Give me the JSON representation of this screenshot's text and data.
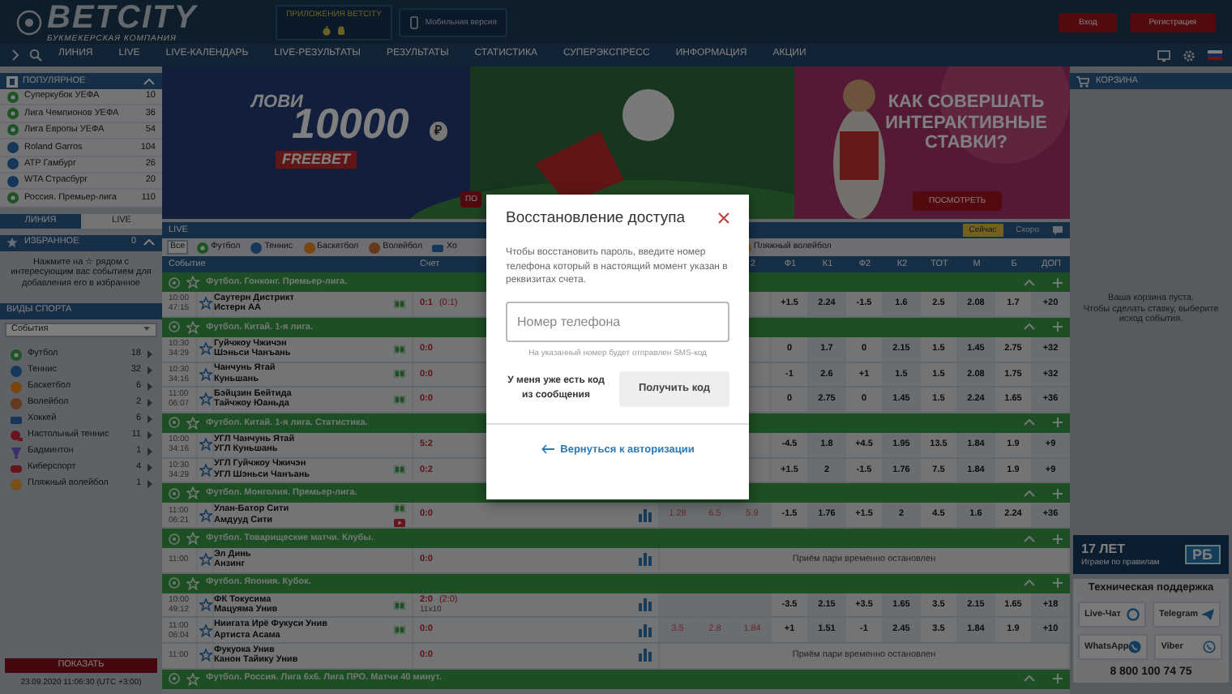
{
  "header": {
    "logo": "BETCITY",
    "tagline": "БУКМЕКЕРСКАЯ КОМПАНИЯ",
    "apps_label": "ПРИЛОЖЕНИЯ BETCITY",
    "mobile_button": "Мобильная версия",
    "login_button": "Вход",
    "register_button": "Регистрация"
  },
  "nav": [
    "ЛИНИЯ",
    "LIVE",
    "LIVE-КАЛЕНДАРЬ",
    "LIVE-РЕЗУЛЬТАТЫ",
    "РЕЗУЛЬТАТЫ",
    "СТАТИСТИКА",
    "СУПЕРЭКСПРЕСС",
    "ИНФОРМАЦИЯ",
    "АКЦИИ"
  ],
  "popular": {
    "title": "ПОПУЛЯРНОЕ",
    "items": [
      {
        "name": "Суперкубок УЕФА",
        "count": "10",
        "kind": "football"
      },
      {
        "name": "Лига Чемпионов УЕФА",
        "count": "36",
        "kind": "football"
      },
      {
        "name": "Лига Европы УЕФА",
        "count": "54",
        "kind": "football"
      },
      {
        "name": "Roland Garros",
        "count": "104",
        "kind": "tennis"
      },
      {
        "name": "ATP Гамбург",
        "count": "26",
        "kind": "tennis"
      },
      {
        "name": "WTA Страсбург",
        "count": "20",
        "kind": "tennis"
      },
      {
        "name": "Россия. Премьер-лига",
        "count": "110",
        "kind": "football"
      }
    ]
  },
  "side_tabs": [
    {
      "label": "ЛИНИЯ",
      "selected": false
    },
    {
      "label": "LIVE",
      "selected": true
    }
  ],
  "favorites": {
    "title": "ИЗБРАННОЕ",
    "count": "0",
    "hint": "Нажмите на ☆ рядом с интересующим вас событием для добавления его в избранное"
  },
  "sports": {
    "title": "ВИДЫ СПОРТА",
    "filter": "События",
    "items": [
      {
        "name": "Футбол",
        "count": "18",
        "kind": "football"
      },
      {
        "name": "Теннис",
        "count": "32",
        "kind": "tennis"
      },
      {
        "name": "Баскетбол",
        "count": "6",
        "kind": "basketball"
      },
      {
        "name": "Волейбол",
        "count": "2",
        "kind": "volleyball"
      },
      {
        "name": "Хоккей",
        "count": "6",
        "kind": "hockey"
      },
      {
        "name": "Настольный теннис",
        "count": "11",
        "kind": "tabletennis"
      },
      {
        "name": "Бадминтон",
        "count": "1",
        "kind": "badminton"
      },
      {
        "name": "Киберспорт",
        "count": "4",
        "kind": "esports"
      },
      {
        "name": "Пляжный волейбол",
        "count": "1",
        "kind": "beach"
      }
    ]
  },
  "show_button": "ПОКАЗАТЬ",
  "datetime": "23.09.2020 11:06:30 (UTC +3:00)",
  "banner": {
    "catch": "ЛОВИ",
    "amount": "10000",
    "currency": "₽",
    "tag": "FREEBET",
    "left_button": "ПО",
    "headline": "КАК СОВЕРШАТЬ ИНТЕРАКТИВНЫЕ СТАВКИ?",
    "button": "ПОСМОТРЕТЬ"
  },
  "live": {
    "title": "LIVE",
    "toggle": [
      {
        "label": "Сейчас",
        "selected": true
      },
      {
        "label": "Скоро",
        "selected": false
      }
    ]
  },
  "sport_filter": [
    {
      "label": "Все",
      "kind": "all",
      "selected": true
    },
    {
      "label": "Футбол",
      "kind": "football",
      "selected": false
    },
    {
      "label": "Теннис",
      "kind": "tennis",
      "selected": false
    },
    {
      "label": "Баскетбол",
      "kind": "basketball",
      "selected": false
    },
    {
      "label": "Волейбол",
      "kind": "volleyball",
      "selected": false
    },
    {
      "label": "Хо",
      "kind": "hockey",
      "selected": false
    },
    {
      "label": "Пляжный волейбол",
      "kind": "beach",
      "selected": false
    }
  ],
  "table": {
    "columns": [
      "Событие",
      "Счет",
      "2",
      "Ф1",
      "К1",
      "Ф2",
      "К2",
      "ТОТ",
      "М",
      "Б",
      "ДОП"
    ],
    "rows": [
      {
        "kind": "league",
        "title": "Футбол. Гонконг. Премьер-лига."
      },
      {
        "kind": "event",
        "time": "10:00",
        "clock": "47:15",
        "home": "Саутерн Дистрикт",
        "away": "Истерн АА",
        "stats": false,
        "score": "0:1",
        "half": "(0:1)",
        "field": true,
        "video": false,
        "odds": [
          "+1.5",
          "2.24",
          "-1.5",
          "1.6",
          "2.5",
          "2.08",
          "1.7",
          "+20"
        ]
      },
      {
        "kind": "league",
        "title": "Футбол. Китай. 1-я лига."
      },
      {
        "kind": "event",
        "time": "10:30",
        "clock": "34:29",
        "home": "Гуйчжоу Чжичэн",
        "away": "Шэньси Чанъань",
        "stats": false,
        "score": "0:0",
        "field": true,
        "video": false,
        "odds": [
          "0",
          "1.7",
          "0",
          "2.15",
          "1.5",
          "1.45",
          "2.75",
          "+32"
        ]
      },
      {
        "kind": "event",
        "time": "10:30",
        "clock": "34:16",
        "home": "Чанчунь Ятай",
        "away": "Куньшань",
        "stats": false,
        "score": "0:0",
        "field": true,
        "video": false,
        "odds": [
          "-1",
          "2.6",
          "+1",
          "1.5",
          "1.5",
          "2.08",
          "1.75",
          "+32"
        ]
      },
      {
        "kind": "event",
        "time": "11:00",
        "clock": "06:07",
        "home": "Бэйцзин Бейтида",
        "away": "Тайчжоу Юаньда",
        "stats": false,
        "score": "0:0",
        "field": true,
        "video": false,
        "odds": [
          "0",
          "2.75",
          "0",
          "1.45",
          "1.5",
          "2.24",
          "1.65",
          "+36"
        ]
      },
      {
        "kind": "league",
        "title": "Футбол. Китай. 1-я лига. Статистика."
      },
      {
        "kind": "event",
        "time": "10:00",
        "clock": "34:16",
        "home": "УГЛ Чанчунь Ятай",
        "away": "УГЛ Куньшань",
        "stats": false,
        "score": "5:2",
        "field": false,
        "video": false,
        "odds": [
          "-4.5",
          "1.8",
          "+4.5",
          "1.95",
          "13.5",
          "1.84",
          "1.9",
          "+9"
        ]
      },
      {
        "kind": "event",
        "time": "10:30",
        "clock": "34:29",
        "home": "УГЛ Гуйчжоу Чжичэн",
        "away": "УГЛ Шэньси Чанъань",
        "stats": false,
        "score": "0:2",
        "field": true,
        "video": false,
        "odds": [
          "+1.5",
          "2",
          "-1.5",
          "1.76",
          "7.5",
          "1.84",
          "1.9",
          "+9"
        ]
      },
      {
        "kind": "league",
        "title": "Футбол. Монголия. Премьер-лига."
      },
      {
        "kind": "event",
        "time": "11:00",
        "clock": "06:21",
        "home": "Улан-Батор Сити",
        "away": "Амдууд Сити",
        "stats": true,
        "score": "0:0",
        "field": true,
        "video": true,
        "odds_1x2": [
          "1.28",
          "6.5",
          "5.9"
        ],
        "odds": [
          "-1.5",
          "1.76",
          "+1.5",
          "2",
          "4.5",
          "1.6",
          "2.24",
          "+36"
        ]
      },
      {
        "kind": "league",
        "title": "Футбол. Товарищеские матчи. Клубы."
      },
      {
        "kind": "event",
        "time": "11:00",
        "home": "Эл Динь",
        "away": "Анзинг",
        "stats": true,
        "score": "0:0",
        "field": false,
        "video": false,
        "notice": "Приём пари временно остановлен"
      },
      {
        "kind": "league",
        "title": "Футбол. Япония. Кубок."
      },
      {
        "kind": "event",
        "time": "10:00",
        "clock": "49:12",
        "home": "ФК Токусима",
        "away": "Мацуяма Унив",
        "stats": true,
        "score": "2:0",
        "half": "(2:0)",
        "extra": "11x10",
        "field": true,
        "video": false,
        "odds": [
          "-3.5",
          "2.15",
          "+3.5",
          "1.65",
          "3.5",
          "2.15",
          "1.65",
          "+18"
        ]
      },
      {
        "kind": "event",
        "time": "11:00",
        "clock": "06:04",
        "home": "Ниигата Ирё Фукуси Унив",
        "away": "Артиста Асама",
        "stats": true,
        "score": "0:0",
        "field": true,
        "video": false,
        "odds_1x2": [
          "3.5",
          "2.8",
          "1.84"
        ],
        "odds": [
          "+1",
          "1.51",
          "-1",
          "2.45",
          "3.5",
          "1.84",
          "1.9",
          "+10"
        ]
      },
      {
        "kind": "event",
        "time": "11:00",
        "home": "Фукуока Унив",
        "away": "Канон Тайику Унив",
        "stats": true,
        "score": "0:0",
        "field": false,
        "video": false,
        "notice": "Приём пари временно остановлен"
      },
      {
        "kind": "league",
        "title": "Футбол. Россия. Лига 6x6. Лига ПРО. Матчи 40 минут."
      }
    ]
  },
  "basket": {
    "title": "КОРЗИНА",
    "empty": "Ваша корзина пуста.",
    "hint": "Чтобы сделать ставку, выберите исход события."
  },
  "age": {
    "title": "17 ЛЕТ",
    "subtitle": "Играем по правилам",
    "badge": "РБ"
  },
  "support": {
    "title": "Техническая поддержка",
    "channels": [
      {
        "label": "Live-Чат",
        "kind": "chat"
      },
      {
        "label": "Telegram",
        "kind": "telegram"
      },
      {
        "label": "WhatsApp",
        "kind": "whatsapp"
      },
      {
        "label": "Viber",
        "kind": "viber"
      }
    ],
    "phone": "8 800 100 74 75"
  },
  "modal": {
    "title": "Восстановление доступа",
    "text": "Чтобы восстановить пароль, введите номер телефона который в настоящий момент указан в реквизитах счета.",
    "placeholder": "Номер телефона",
    "hint": "На указанный номер будет отправлен SMS-код",
    "have_code": "У меня уже есть код из сообщения",
    "get_code": "Получить код",
    "back": "Вернуться к авторизации"
  }
}
